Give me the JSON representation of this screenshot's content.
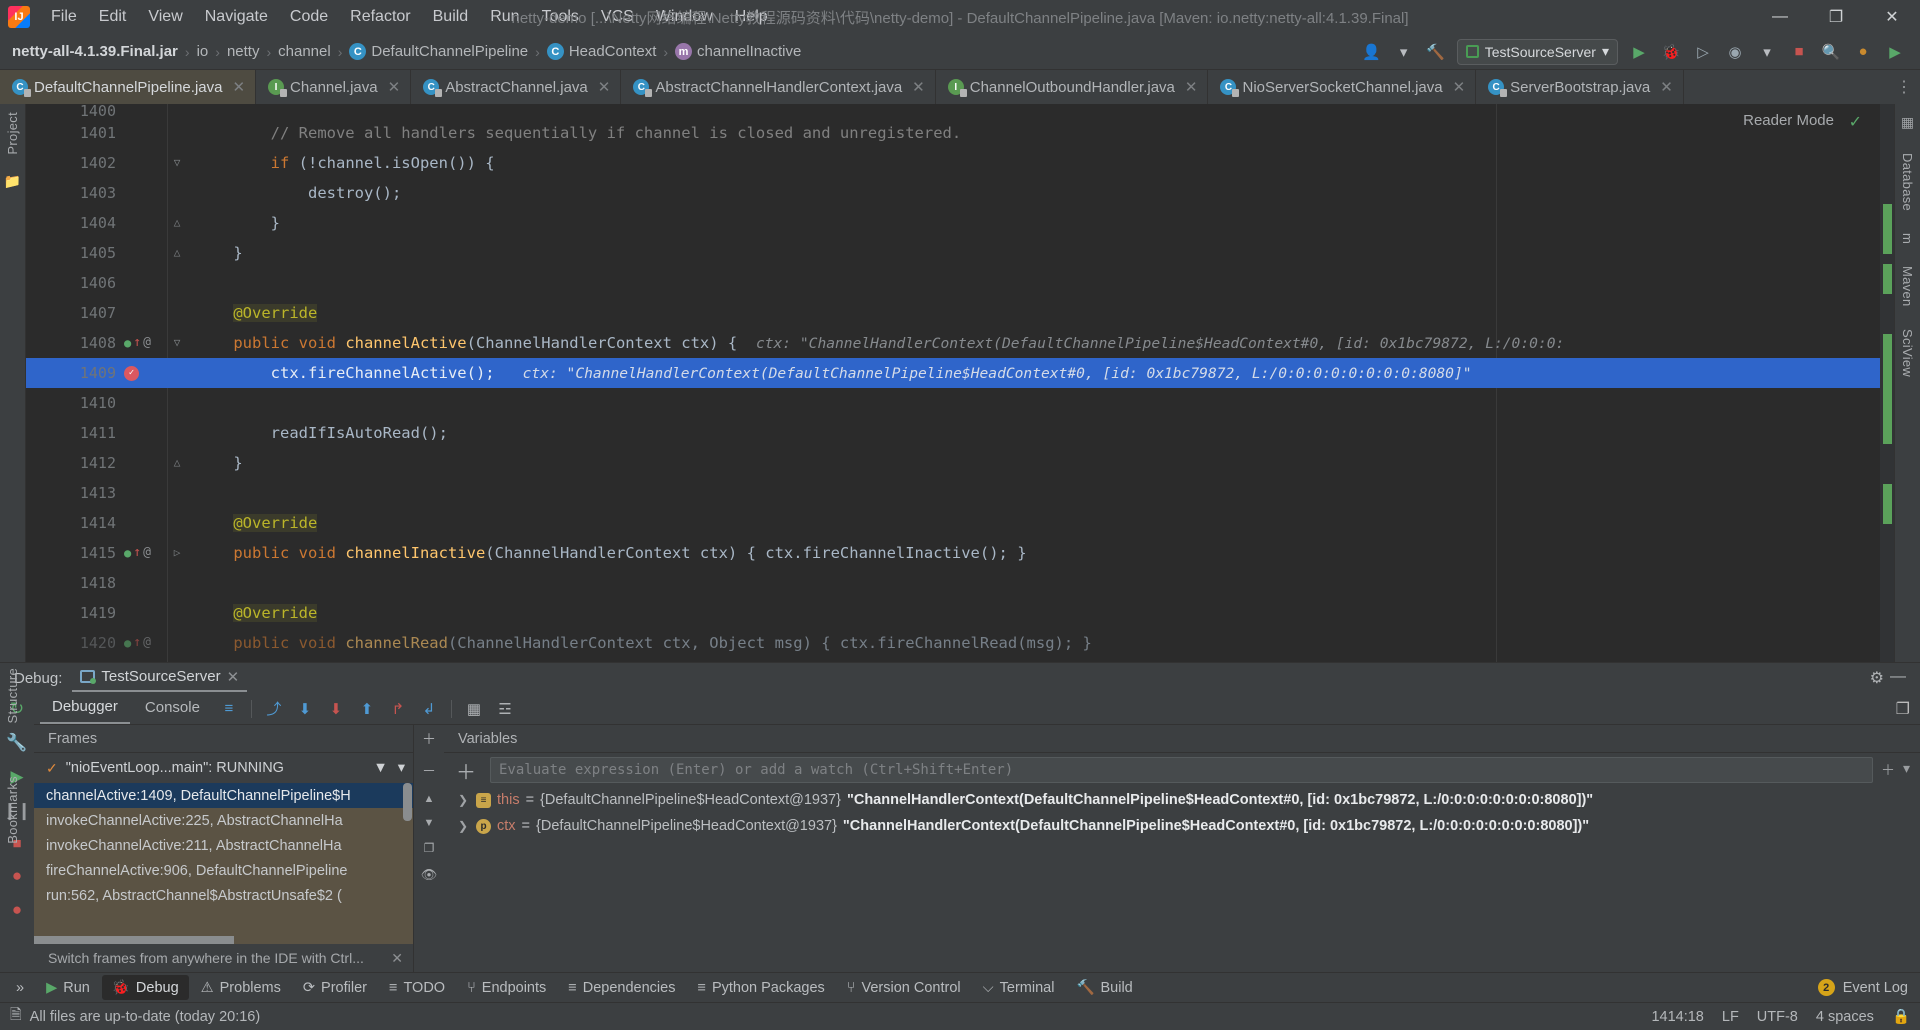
{
  "window": {
    "title": "netty-demo [...\\Netty网络编程\\Netty教程源码资料\\代码\\netty-demo] - DefaultChannelPipeline.java [Maven: io.netty:netty-all:4.1.39.Final]",
    "minimize": "—",
    "maximize": "❐",
    "close": "✕",
    "logo_text": "IJ"
  },
  "menu": {
    "items": [
      "File",
      "Edit",
      "View",
      "Navigate",
      "Code",
      "Refactor",
      "Build",
      "Run",
      "Tools",
      "VCS",
      "Window",
      "Help"
    ]
  },
  "breadcrumb": {
    "items": [
      {
        "label": "netty-all-4.1.39.Final.jar",
        "icon": "",
        "strong": true
      },
      {
        "label": "io",
        "icon": ""
      },
      {
        "label": "netty",
        "icon": ""
      },
      {
        "label": "channel",
        "icon": ""
      },
      {
        "label": "DefaultChannelPipeline",
        "icon": "class-icon"
      },
      {
        "label": "HeadContext",
        "icon": "class-icon"
      },
      {
        "label": "channelInactive",
        "icon": "method-icon"
      }
    ]
  },
  "toolbar": {
    "run_config": "TestSourceServer",
    "dropdown_caret": "▾",
    "icons": [
      {
        "name": "user-settings-icon",
        "glyph": "👤"
      },
      {
        "name": "hammer-build-icon",
        "glyph": "🔨"
      },
      {
        "name": "run-icon",
        "glyph": "▶"
      },
      {
        "name": "debug-icon",
        "glyph": "🐞"
      },
      {
        "name": "run-coverage-icon",
        "glyph": "▷"
      },
      {
        "name": "profile-icon",
        "glyph": "◉"
      },
      {
        "name": "stop-icon",
        "glyph": "■"
      },
      {
        "name": "search-everywhere-icon",
        "glyph": "🔍"
      },
      {
        "name": "account-icon",
        "glyph": "●"
      },
      {
        "name": "updates-icon",
        "glyph": "▶"
      }
    ]
  },
  "editor_tabs": [
    {
      "label": "DefaultChannelPipeline.java",
      "icon": "class-icon",
      "kind": "c",
      "active": true
    },
    {
      "label": "Channel.java",
      "icon": "interface-icon",
      "kind": "i",
      "active": false
    },
    {
      "label": "AbstractChannel.java",
      "icon": "class-icon",
      "kind": "c",
      "active": false
    },
    {
      "label": "AbstractChannelHandlerContext.java",
      "icon": "class-icon",
      "kind": "c",
      "active": false
    },
    {
      "label": "ChannelOutboundHandler.java",
      "icon": "interface-icon",
      "kind": "i",
      "active": false
    },
    {
      "label": "NioServerSocketChannel.java",
      "icon": "class-icon",
      "kind": "c",
      "active": false
    },
    {
      "label": "ServerBootstrap.java",
      "icon": "class-icon",
      "kind": "c",
      "active": false
    }
  ],
  "editor": {
    "reader_mode": "Reader Mode",
    "reader_check": "✓",
    "tabs_overflow": "⋮",
    "lines": [
      {
        "num": "1400",
        "partial": true
      },
      {
        "num": "1401"
      },
      {
        "num": "1402",
        "fold": "▽"
      },
      {
        "num": "1403"
      },
      {
        "num": "1404",
        "fold": "△"
      },
      {
        "num": "1405",
        "fold": "△"
      },
      {
        "num": "1406"
      },
      {
        "num": "1407"
      },
      {
        "num": "1408",
        "fold": "▽",
        "gutter": "impl-override"
      },
      {
        "num": "1409",
        "highlight": true,
        "gutter": "breakpoint"
      },
      {
        "num": "1410"
      },
      {
        "num": "1411"
      },
      {
        "num": "1412",
        "fold": "△"
      },
      {
        "num": "1413"
      },
      {
        "num": "1414"
      },
      {
        "num": "1415",
        "gutter": "impl-override"
      },
      {
        "num": "1418"
      },
      {
        "num": "1419"
      },
      {
        "num": "1420",
        "gutter": "impl-override",
        "partial": true
      }
    ],
    "code": {
      "l1401_comment": "// Remove all handlers sequentially if channel is closed and unregistered.",
      "l1402_kw": "if",
      "l1402_rest": " (!channel.isOpen()) {",
      "l1403": "destroy();",
      "l1404": "}",
      "l1405": "}",
      "l1407_annotation": "@Override",
      "l1408_kw": "public void ",
      "l1408_fn": "channelActive",
      "l1408_rest": "(ChannelHandlerContext ctx) {",
      "l1408_hint": "ctx: \"ChannelHandlerContext(DefaultChannelPipeline$HeadContext#0, [id: 0x1bc79872, L:/0:0:0:",
      "l1409_code": "ctx.fireChannelActive();",
      "l1409_hint": "ctx: \"ChannelHandlerContext(DefaultChannelPipeline$HeadContext#0, [id: 0x1bc79872, L:/0:0:0:0:0:0:0:0:8080]\"",
      "l1411": "readIfIsAutoRead();",
      "l1412": "}",
      "l1414_annotation": "@Override",
      "l1415_kw": "public void ",
      "l1415_fn": "channelInactive",
      "l1415_rest": "(ChannelHandlerContext ctx) { ctx.fireChannelInactive(); }",
      "l1419_annotation": "@Override",
      "l1420_kw": "public void ",
      "l1420_fn": "channelRead",
      "l1420_rest": "(ChannelHandlerContext ctx, Object msg) { ctx.fireChannelRead(msg); }"
    }
  },
  "left_strip": {
    "items": [
      {
        "label": "Project",
        "name": "tool-project"
      },
      {
        "label": "Structure",
        "name": "tool-structure"
      },
      {
        "label": "Bookmarks",
        "name": "tool-bookmarks"
      }
    ]
  },
  "right_strip": {
    "items": [
      {
        "label": "Database",
        "name": "tool-database"
      },
      {
        "label": "m",
        "name": "tool-maven-m"
      },
      {
        "label": "Maven",
        "name": "tool-maven"
      },
      {
        "label": "SciView",
        "name": "tool-sciview"
      }
    ]
  },
  "debug": {
    "header_label": "Debug:",
    "session_name": "TestSourceServer",
    "close_glyph": "✕",
    "settings_glyph": "⚙",
    "minimize_glyph": "—",
    "tabs": [
      {
        "label": "Debugger",
        "active": true
      },
      {
        "label": "Console",
        "active": false
      }
    ],
    "toolbar_icons": [
      {
        "name": "layout-settings-icon",
        "glyph": "≡"
      },
      {
        "name": "step-over-icon",
        "glyph": "⤴"
      },
      {
        "name": "step-into-icon",
        "glyph": "⬇"
      },
      {
        "name": "force-step-into-icon",
        "glyph": "⬇"
      },
      {
        "name": "step-out-icon",
        "glyph": "⬆"
      },
      {
        "name": "drop-frame-icon",
        "glyph": "↱"
      },
      {
        "name": "run-to-cursor-icon",
        "glyph": "↲"
      },
      {
        "name": "evaluate-expression-icon",
        "glyph": "▦"
      },
      {
        "name": "settings-icon",
        "glyph": "☲"
      }
    ],
    "restore_layout_glyph": "❐",
    "side_icons": [
      {
        "name": "rerun-icon",
        "glyph": "↻"
      },
      {
        "name": "settings-wrench-icon",
        "glyph": "🔧"
      },
      {
        "name": "resume-program-icon",
        "glyph": "▶"
      },
      {
        "name": "pause-program-icon",
        "glyph": "❙❙"
      },
      {
        "name": "stop-icon",
        "glyph": "■"
      },
      {
        "name": "view-breakpoints-icon",
        "glyph": "●"
      },
      {
        "name": "mute-breakpoints-icon",
        "glyph": "●"
      }
    ],
    "frames": {
      "title": "Frames",
      "thread": "\"nioEventLoop...main\": RUNNING",
      "filter_glyph": "▼",
      "caret_glyph": "▾",
      "items": [
        {
          "label": "channelActive:1409, DefaultChannelPipeline$H",
          "selected": true
        },
        {
          "label": "invokeChannelActive:225, AbstractChannelHa",
          "selected": false
        },
        {
          "label": "invokeChannelActive:211, AbstractChannelHa",
          "selected": false
        },
        {
          "label": "fireChannelActive:906, DefaultChannelPipeline",
          "selected": false
        },
        {
          "label": "run:562, AbstractChannel$AbstractUnsafe$2 (",
          "selected": false
        }
      ],
      "side_icons": [
        {
          "name": "add-frame-icon",
          "glyph": "＋"
        },
        {
          "name": "remove-frame-icon",
          "glyph": "－"
        },
        {
          "name": "move-up-icon",
          "glyph": "▲"
        },
        {
          "name": "move-down-icon",
          "glyph": "▼"
        },
        {
          "name": "copy-icon",
          "glyph": "❐"
        },
        {
          "name": "preview-eye-icon",
          "glyph": "👁"
        }
      ],
      "tip": "Switch frames from anywhere in the IDE with Ctrl...",
      "tip_close": "✕"
    },
    "variables": {
      "title": "Variables",
      "watch_placeholder": "Evaluate expression (Enter) or add a watch (Ctrl+Shift+Enter)",
      "watch_add": "＋",
      "watch_right": [
        "＋",
        "▾"
      ],
      "rows": [
        {
          "chevron": "❯",
          "icon": "object-icon",
          "icon_glyph": "≡",
          "icon_kind": "obj",
          "name": "this",
          "eq": " = ",
          "value": "{DefaultChannelPipeline$HeadContext@1937} ",
          "string": "\"ChannelHandlerContext(DefaultChannelPipeline$HeadContext#0, [id: 0x1bc79872, L:/0:0:0:0:0:0:0:0:8080])\""
        },
        {
          "chevron": "❯",
          "icon": "parameter-icon",
          "icon_glyph": "p",
          "icon_kind": "par",
          "name": "ctx",
          "eq": " = ",
          "value": "{DefaultChannelPipeline$HeadContext@1937} ",
          "string": "\"ChannelHandlerContext(DefaultChannelPipeline$HeadContext#0, [id: 0x1bc79872, L:/0:0:0:0:0:0:0:0:8080])\""
        }
      ]
    }
  },
  "toolwindows": {
    "expand_glyph": "»",
    "items": [
      {
        "label": "Run",
        "icon": "run-icon",
        "glyph": "▶",
        "active": false
      },
      {
        "label": "Debug",
        "icon": "debug-icon",
        "glyph": "🐞",
        "active": true
      },
      {
        "label": "Problems",
        "icon": "problems-icon",
        "glyph": "⚠",
        "active": false
      },
      {
        "label": "Profiler",
        "icon": "profiler-icon",
        "glyph": "⟳",
        "active": false
      },
      {
        "label": "TODO",
        "icon": "todo-icon",
        "glyph": "≡",
        "active": false
      },
      {
        "label": "Endpoints",
        "icon": "endpoints-icon",
        "glyph": "⑂",
        "active": false
      },
      {
        "label": "Dependencies",
        "icon": "dependencies-icon",
        "glyph": "≡",
        "active": false
      },
      {
        "label": "Python Packages",
        "icon": "python-icon",
        "glyph": "≡",
        "active": false
      },
      {
        "label": "Version Control",
        "icon": "vcs-icon",
        "glyph": "⑂",
        "active": false
      },
      {
        "label": "Terminal",
        "icon": "terminal-icon",
        "glyph": "⌵",
        "active": false
      },
      {
        "label": "Build",
        "icon": "build-icon",
        "glyph": "🔨",
        "active": false
      }
    ],
    "event_log": {
      "label": "Event Log",
      "count": "2",
      "icon": "event-log-icon",
      "glyph": "≡"
    }
  },
  "status": {
    "icon": "file-icon",
    "message": "All files are up-to-date (today 20:16)",
    "caret_position": "1414:18",
    "line_separator": "LF",
    "encoding": "UTF-8",
    "indent": "4 spaces",
    "lock_icon": "🔒"
  },
  "colors": {
    "accent_blue": "#2f65ca",
    "panel_bg": "#3c3f41",
    "editor_bg": "#2b2b2b",
    "tab_active_bg": "#4e4b41",
    "frames_bg": "#5b5344",
    "frame_selected": "#1b3a5c",
    "keyword": "#cc7832",
    "string": "#6a8759",
    "comment": "#808080",
    "annotation": "#bbb529",
    "method": "#ffc66d",
    "field": "#9876aa"
  }
}
